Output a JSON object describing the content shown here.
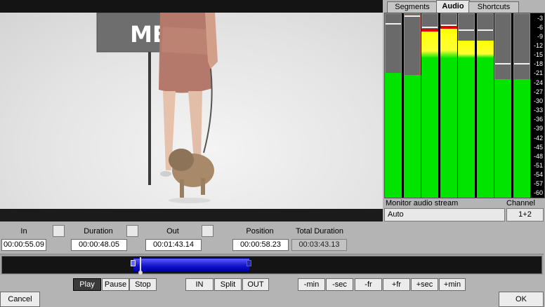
{
  "video": {
    "sign_text": "ME"
  },
  "tabs": [
    {
      "label": "Segments",
      "active": false
    },
    {
      "label": "Audio",
      "active": true
    },
    {
      "label": "Shortcuts",
      "active": false
    }
  ],
  "audio_meter": {
    "scale_db": [
      "-3",
      "-6",
      "-9",
      "-12",
      "-15",
      "-18",
      "-21",
      "-24",
      "-27",
      "-30",
      "-33",
      "-36",
      "-39",
      "-42",
      "-45",
      "-48",
      "-51",
      "-54",
      "-57",
      "-60"
    ],
    "channels": [
      {
        "level_db": -21,
        "hold_db": -4.5,
        "peak": false
      },
      {
        "level_db": -21.5,
        "hold_db": -2,
        "peak": false
      },
      {
        "level_db": -6.5,
        "hold_db": -5.5,
        "peak": true
      },
      {
        "level_db": -5.5,
        "hold_db": -5,
        "peak": true
      },
      {
        "level_db": -10.5,
        "hold_db": -6.5,
        "peak": false
      },
      {
        "level_db": -10.5,
        "hold_db": -6.5,
        "peak": false
      },
      {
        "level_db": -23,
        "hold_db": -17.5,
        "peak": false
      },
      {
        "level_db": -23,
        "hold_db": -17.5,
        "peak": false
      }
    ],
    "colors": {
      "green": "#00e400",
      "yellow": "#ffff00",
      "red": "#e00000"
    }
  },
  "monitor": {
    "label": "Monitor audio stream",
    "value": "Auto",
    "channel_label": "Channel",
    "channel_value": "1+2"
  },
  "fields": {
    "in": {
      "label": "In",
      "value": "00:00:55.09"
    },
    "duration": {
      "label": "Duration",
      "value": "00:00:48.05"
    },
    "out": {
      "label": "Out",
      "value": "00:01:43.14"
    },
    "position": {
      "label": "Position",
      "value": "00:00:58.23"
    },
    "total": {
      "label": "Total Duration",
      "value": "00:03:43.13"
    }
  },
  "transport": {
    "play": "Play",
    "pause": "Pause",
    "stop": "Stop",
    "in": "IN",
    "split": "Split",
    "out": "OUT",
    "minus_min": "-min",
    "minus_sec": "-sec",
    "minus_fr": "-fr",
    "plus_fr": "+fr",
    "plus_sec": "+sec",
    "plus_min": "+min"
  },
  "dialog": {
    "cancel": "Cancel",
    "ok": "OK"
  }
}
